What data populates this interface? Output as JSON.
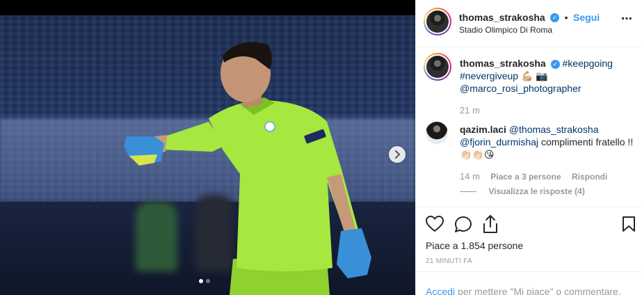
{
  "post": {
    "author": "thomas_strakosha",
    "follow_label": "Segui",
    "separator": "•",
    "location": "Stadio Olimpico Di Roma"
  },
  "caption": {
    "author": "thomas_strakosha",
    "tag1": "#keepgoing",
    "tag2": "#nevergiveup",
    "emojis": "💪🏼 📷",
    "mention": "@marco_rosi_photographer",
    "time": "21 m"
  },
  "comment": {
    "author": "qazim.laci",
    "mention1": "@thomas_strakosha",
    "mention2": "@fjorin_durmishaj",
    "text": "complimenti fratello !! 👏🏻👏🏻😘",
    "time": "14 m",
    "likes": "Piace a 3 persone",
    "reply": "Rispondi",
    "view_replies": "Visualizza le risposte (4)"
  },
  "engagement": {
    "likes_text": "Piace a 1.854 persone",
    "time_ago": "21 MINUTI FA"
  },
  "login": {
    "link": "Accedi",
    "text": " per mettere \"Mi piace\" o commentare."
  },
  "carousel": {
    "slide_count": 2,
    "active_index": 0
  },
  "icons": {
    "like": "heart-icon",
    "comment": "comment-icon",
    "share": "share-icon",
    "save": "bookmark-icon",
    "next": "chevron-right-icon",
    "verified": "verified-badge-icon",
    "more": "more-options-icon"
  },
  "colors": {
    "accent_blue": "#3897f0",
    "link_dark": "#003569",
    "jersey_green": "#9be03a",
    "glove_blue": "#3a8fd9"
  }
}
